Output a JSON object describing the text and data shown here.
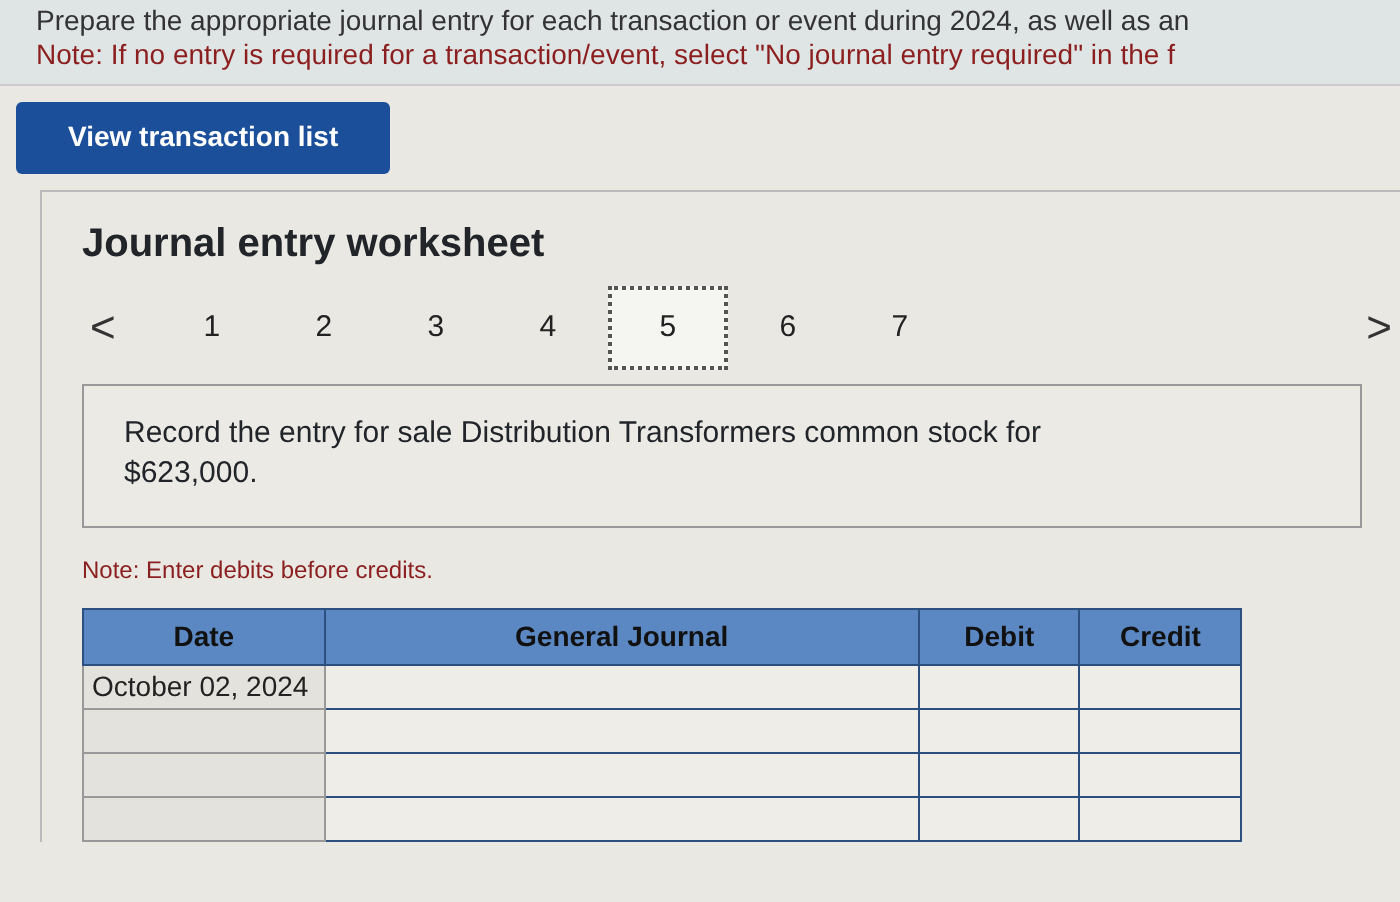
{
  "instructions": {
    "text": "Prepare the appropriate journal entry for each transaction or event during 2024, as well as an",
    "note": "Note: If no entry is required for a transaction/event, select \"No journal entry required\" in the f"
  },
  "view_button": "View transaction list",
  "worksheet": {
    "title": "Journal entry worksheet",
    "prev": "<",
    "next": ">",
    "tabs": [
      {
        "label": "1",
        "selected": false
      },
      {
        "label": "2",
        "selected": false
      },
      {
        "label": "3",
        "selected": false
      },
      {
        "label": "4",
        "selected": false
      },
      {
        "label": "5",
        "selected": true
      },
      {
        "label": "6",
        "selected": false
      },
      {
        "label": "7",
        "selected": false
      }
    ],
    "prompt": "Record the entry for sale Distribution Transformers common stock for $623,000.",
    "note": "Note: Enter debits before credits.",
    "table": {
      "columns": [
        "Date",
        "General Journal",
        "Debit",
        "Credit"
      ],
      "rows": [
        {
          "date": "October 02, 2024"
        },
        {},
        {},
        {}
      ]
    }
  }
}
